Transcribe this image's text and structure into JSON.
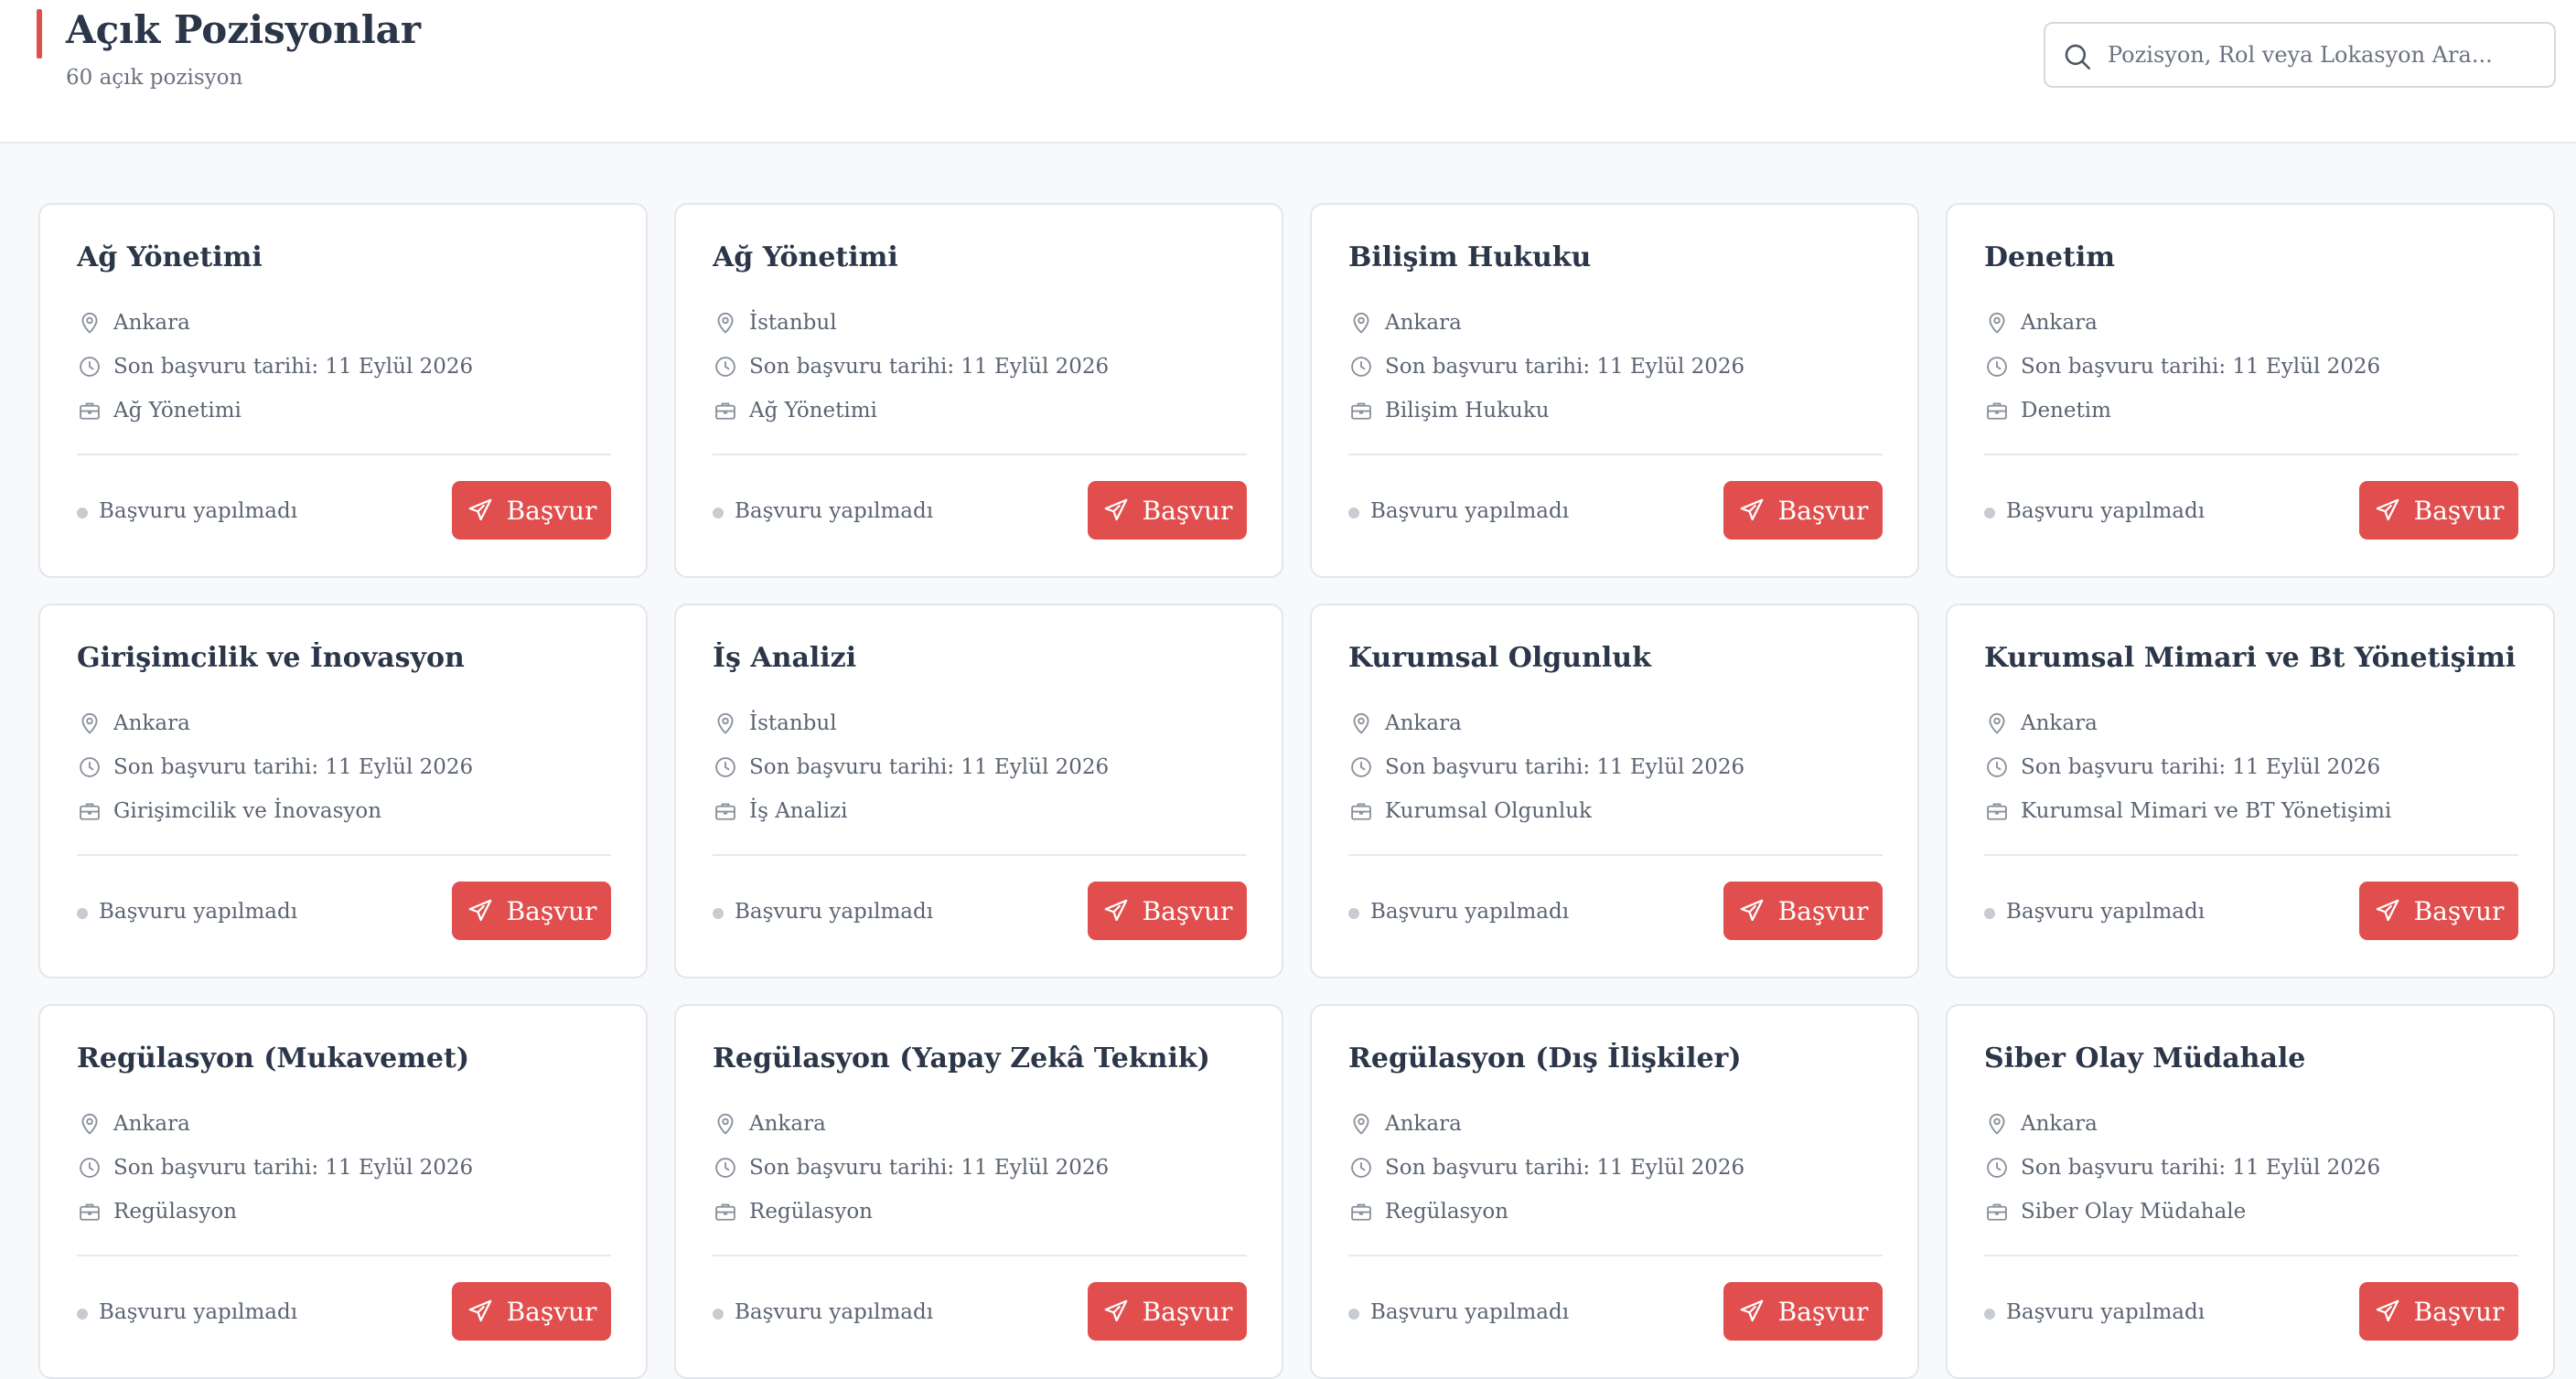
{
  "header": {
    "title": "Açık Pozisyonlar",
    "subtitle": "60 açık pozisyon",
    "accent_color": "#e0504e"
  },
  "search": {
    "placeholder": "Pozisyon, Rol veya Lokasyon Ara...",
    "value": "",
    "icon": "search-icon"
  },
  "cards": [
    {
      "title": "Ağ Yönetimi",
      "location": "Ankara",
      "deadline": "Son başvuru tarihi: 11 Eylül 2026",
      "category": "Ağ Yönetimi",
      "status": "Başvuru yapılmadı",
      "apply_label": "Başvur"
    },
    {
      "title": "Ağ Yönetimi",
      "location": "İstanbul",
      "deadline": "Son başvuru tarihi: 11 Eylül 2026",
      "category": "Ağ Yönetimi",
      "status": "Başvuru yapılmadı",
      "apply_label": "Başvur"
    },
    {
      "title": "Bilişim Hukuku",
      "location": "Ankara",
      "deadline": "Son başvuru tarihi: 11 Eylül 2026",
      "category": "Bilişim Hukuku",
      "status": "Başvuru yapılmadı",
      "apply_label": "Başvur"
    },
    {
      "title": "Denetim",
      "location": "Ankara",
      "deadline": "Son başvuru tarihi: 11 Eylül 2026",
      "category": "Denetim",
      "status": "Başvuru yapılmadı",
      "apply_label": "Başvur"
    },
    {
      "title": "Girişimcilik ve İnovasyon",
      "location": "Ankara",
      "deadline": "Son başvuru tarihi: 11 Eylül 2026",
      "category": "Girişimcilik ve İnovasyon",
      "status": "Başvuru yapılmadı",
      "apply_label": "Başvur"
    },
    {
      "title": "İş Analizi",
      "location": "İstanbul",
      "deadline": "Son başvuru tarihi: 11 Eylül 2026",
      "category": "İş Analizi",
      "status": "Başvuru yapılmadı",
      "apply_label": "Başvur"
    },
    {
      "title": "Kurumsal Olgunluk",
      "location": "Ankara",
      "deadline": "Son başvuru tarihi: 11 Eylül 2026",
      "category": "Kurumsal Olgunluk",
      "status": "Başvuru yapılmadı",
      "apply_label": "Başvur"
    },
    {
      "title": "Kurumsal Mimari ve Bt Yönetişimi",
      "location": "Ankara",
      "deadline": "Son başvuru tarihi: 11 Eylül 2026",
      "category": "Kurumsal Mimari ve BT Yönetişimi",
      "status": "Başvuru yapılmadı",
      "apply_label": "Başvur"
    },
    {
      "title": "Regülasyon (Mukavemet)",
      "location": "Ankara",
      "deadline": "Son başvuru tarihi: 11 Eylül 2026",
      "category": "Regülasyon",
      "status": "Başvuru yapılmadı",
      "apply_label": "Başvur"
    },
    {
      "title": "Regülasyon (Yapay Zekâ Teknik)",
      "location": "Ankara",
      "deadline": "Son başvuru tarihi: 11 Eylül 2026",
      "category": "Regülasyon",
      "status": "Başvuru yapılmadı",
      "apply_label": "Başvur"
    },
    {
      "title": "Regülasyon (Dış İlişkiler)",
      "location": "Ankara",
      "deadline": "Son başvuru tarihi: 11 Eylül 2026",
      "category": "Regülasyon",
      "status": "Başvuru yapılmadı",
      "apply_label": "Başvur"
    },
    {
      "title": "Siber Olay Müdahale",
      "location": "Ankara",
      "deadline": "Son başvuru tarihi: 11 Eylül 2026",
      "category": "Siber Olay Müdahale",
      "status": "Başvuru yapılmadı",
      "apply_label": "Başvur"
    }
  ],
  "icons": {
    "location": "map-pin-icon",
    "deadline": "clock-icon",
    "category": "briefcase-icon",
    "apply": "send-icon"
  },
  "colors": {
    "button": "#e04f4d",
    "status_dot": "#c7ccd3"
  }
}
